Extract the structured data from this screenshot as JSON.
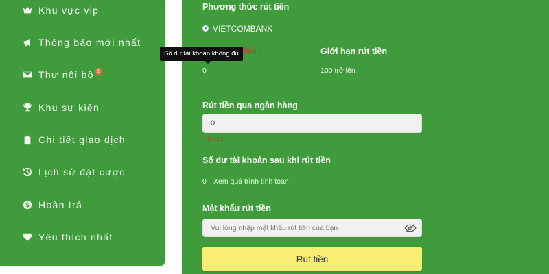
{
  "sidebar": {
    "items": [
      {
        "label": "Khu vực vip",
        "icon": "crown-icon"
      },
      {
        "label": "Thông báo mới nhất",
        "icon": "megaphone-icon"
      },
      {
        "label": "Thư nội bộ",
        "icon": "envelope-icon",
        "badge": "6"
      },
      {
        "label": "Khu sự kiện",
        "icon": "trophy-icon"
      },
      {
        "label": "Chi tiết giao dịch",
        "icon": "clipboard-icon"
      },
      {
        "label": "Lịch sử đặt cược",
        "icon": "history-icon"
      },
      {
        "label": "Hoàn trả",
        "icon": "dollar-icon"
      },
      {
        "label": "Yêu thích nhất",
        "icon": "heart-icon"
      }
    ]
  },
  "withdraw": {
    "method_heading": "Phương thức rút tiền",
    "bank_option": "VIETCOMBANK",
    "balance_label_partial": "huản",
    "balance_value": "0",
    "limit_label": "Giới hạn rút tiền",
    "limit_value": "100 trở lên",
    "tooltip": "Số dư tài khoản không đủ",
    "amount_heading": "Rút tiền qua ngân hàng",
    "amount_value": "0",
    "amount_hint": "= 0 VND",
    "after_heading": "Số dư tài khoản sau khi rút tiền",
    "after_value": "0",
    "after_link": "Xem quá trình tính toán",
    "password_heading": "Mật khẩu rút tiền",
    "password_placeholder": "Vui lòng nhập mật khẩu rút tiền của bạn",
    "submit_label": "Rút tiền"
  },
  "colors": {
    "green": "#3f9b3c",
    "button": "#f9ed74",
    "badge": "#e8643c"
  }
}
